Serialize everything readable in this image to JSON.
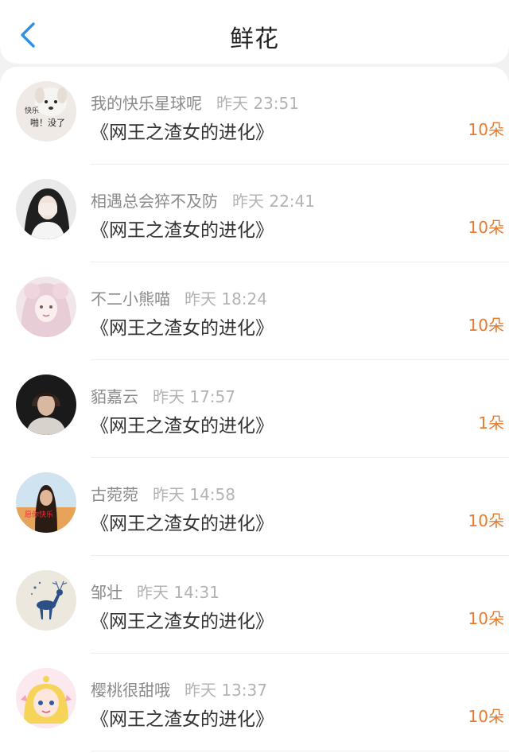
{
  "header": {
    "title": "鲜花",
    "back_icon": "chevron-left-icon",
    "accent": "#2f8fe6"
  },
  "colors": {
    "count": "#e87a2e"
  },
  "rows": [
    {
      "name": "我的快乐星球呢",
      "time": "昨天 23:51",
      "book": "《网王之渣女的进化》",
      "count": "10朵",
      "avatar_text_1": "快乐",
      "avatar_text_2": "啪！没了"
    },
    {
      "name": "相遇总会猝不及防",
      "time": "昨天 22:41",
      "book": "《网王之渣女的进化》",
      "count": "10朵"
    },
    {
      "name": "不二小熊喵",
      "time": "昨天 18:24",
      "book": "《网王之渣女的进化》",
      "count": "10朵"
    },
    {
      "name": "貊嘉云",
      "time": "昨天 17:57",
      "book": "《网王之渣女的进化》",
      "count": "1朵"
    },
    {
      "name": "古菀菀",
      "time": "昨天 14:58",
      "book": "《网王之渣女的进化》",
      "count": "10朵",
      "avatar_text_1": "愿你快乐"
    },
    {
      "name": "邹壮",
      "time": "昨天 14:31",
      "book": "《网王之渣女的进化》",
      "count": "10朵"
    },
    {
      "name": "樱桃很甜哦",
      "time": "昨天 13:37",
      "book": "《网王之渣女的进化》",
      "count": "10朵"
    }
  ]
}
